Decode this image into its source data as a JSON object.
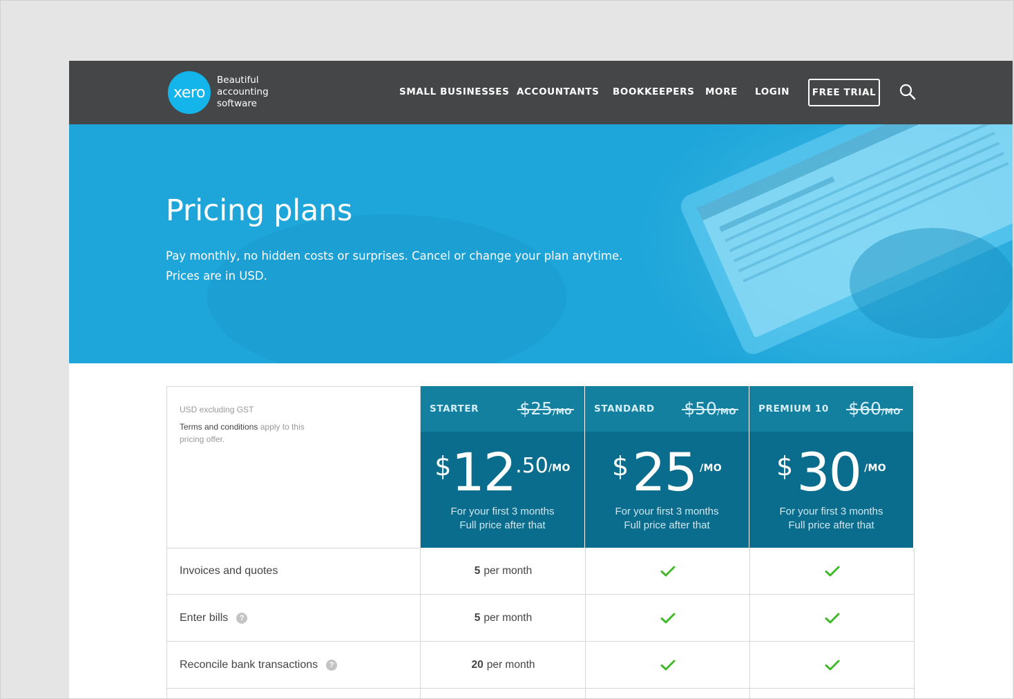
{
  "brand": {
    "logo_text": "xero",
    "tagline": [
      "Beautiful",
      "accounting",
      "software"
    ]
  },
  "nav": {
    "links": [
      "SMALL BUSINESSES",
      "ACCOUNTANTS",
      "BOOKKEEPERS",
      "MORE",
      "LOGIN"
    ],
    "cta": "FREE TRIAL"
  },
  "hero": {
    "title": "Pricing plans",
    "subtitle_lines": [
      "Pay monthly, no hidden costs or surprises. Cancel or change your plan anytime.",
      "Prices are in USD."
    ]
  },
  "info": {
    "currency_note": "USD excluding GST",
    "terms_link": "Terms and conditions",
    "terms_rest": "apply to this pricing offer."
  },
  "plans": [
    {
      "name": "STARTER",
      "old_price": "$25",
      "old_unit": "/MO",
      "currency": "$",
      "price": "12",
      "cents": ".50",
      "unit": "/MO",
      "note": [
        "For your first 3 months",
        "Full price after that"
      ]
    },
    {
      "name": "STANDARD",
      "old_price": "$50",
      "old_unit": "/MO",
      "currency": "$",
      "price": "25",
      "cents": "",
      "unit": "/MO",
      "note": [
        "For your first 3 months",
        "Full price after that"
      ]
    },
    {
      "name": "PREMIUM 10",
      "old_price": "$60",
      "old_unit": "/MO",
      "currency": "$",
      "price": "30",
      "cents": "",
      "unit": "/MO",
      "note": [
        "For your first 3 months",
        "Full price after that"
      ]
    }
  ],
  "features": [
    {
      "label": "Invoices and quotes",
      "help": false,
      "starter_count": "5",
      "starter_unit": "per month"
    },
    {
      "label": "Enter bills",
      "help": true,
      "starter_count": "5",
      "starter_unit": "per month"
    },
    {
      "label": "Reconcile bank transactions",
      "help": true,
      "starter_count": "20",
      "starter_unit": "per month"
    }
  ],
  "icons": {
    "help": "?"
  },
  "colors": {
    "nav_bg": "#454648",
    "brand_blue": "#13b5ea",
    "hero_bg": "#1ea5d9",
    "plan_head": "#13809f",
    "plan_body": "#0a6d8d",
    "check_green": "#3fb928"
  }
}
